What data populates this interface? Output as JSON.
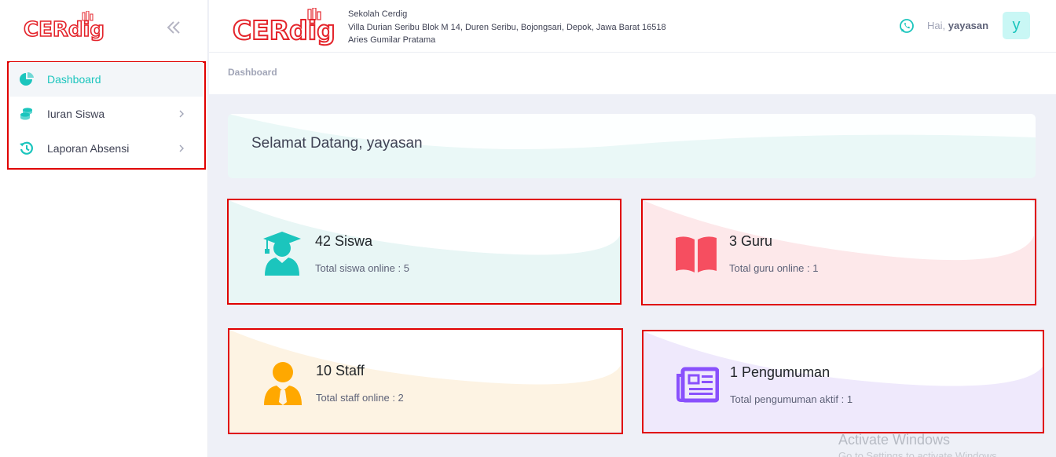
{
  "brand": {
    "logo_text": "CERdig",
    "brand_color": "#e4242b"
  },
  "sidebar": {
    "items": [
      {
        "label": "Dashboard",
        "icon": "pie-chart-icon",
        "active": true
      },
      {
        "label": "Iuran Siswa",
        "icon": "coins-icon",
        "active": false
      },
      {
        "label": "Laporan Absensi",
        "icon": "history-icon",
        "active": false
      }
    ]
  },
  "header": {
    "school_name": "Sekolah Cerdig",
    "address": "Villa Durian Seribu Blok M 14, Duren Seribu, Bojongsari, Depok, Jawa Barat 16518",
    "principal": "Aries Gumilar Pratama",
    "greeting": "Hai,",
    "username": "yayasan",
    "avatar_letter": "y"
  },
  "breadcrumb": {
    "current": "Dashboard"
  },
  "welcome": {
    "title": "Selamat Datang, yayasan"
  },
  "cards": {
    "siswa": {
      "title": "42 Siswa",
      "subtitle": "Total siswa online : 5",
      "icon": "student-graduate-icon",
      "color": "#1bc5bd"
    },
    "guru": {
      "title": "3 Guru",
      "subtitle": "Total guru online : 1",
      "icon": "open-book-icon",
      "color": "#f64e60"
    },
    "staff": {
      "title": "10 Staff",
      "subtitle": "Total staff online : 2",
      "icon": "user-tie-icon",
      "color": "#ffa800"
    },
    "pengumuman": {
      "title": "1 Pengumuman",
      "subtitle": "Total pengumuman aktif : 1",
      "icon": "newspaper-icon",
      "color": "#8950fc"
    }
  },
  "watermark": {
    "line1": "Activate Windows",
    "line2": "Go to Settings to activate Windows."
  }
}
